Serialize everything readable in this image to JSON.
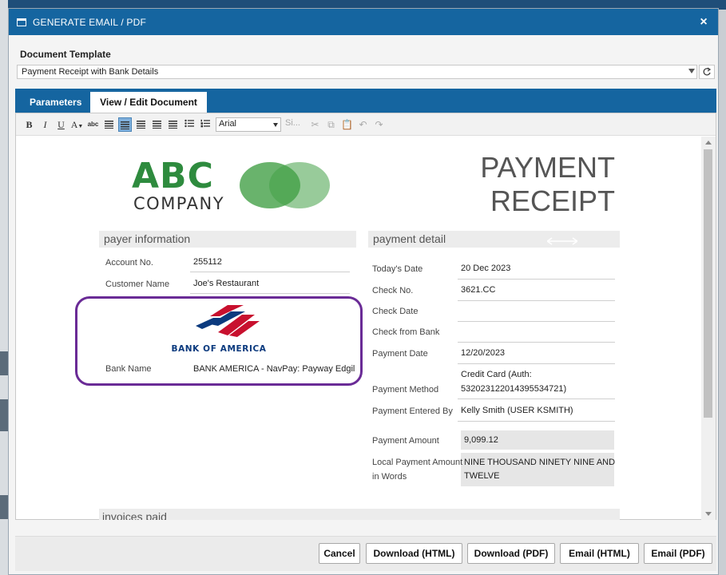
{
  "dialog": {
    "title": "GENERATE EMAIL / PDF",
    "close_label": "×"
  },
  "template": {
    "label": "Document Template",
    "selected": "Payment Receipt with Bank Details"
  },
  "tabs": [
    {
      "label": "Parameters",
      "active": false
    },
    {
      "label": "View / Edit Document",
      "active": true
    }
  ],
  "toolbar": {
    "bold": "B",
    "italic": "I",
    "underline": "U",
    "font_color": "A",
    "spell": "abc",
    "font_family": "Arial",
    "font_size": "Si..."
  },
  "document": {
    "logo": {
      "line1": "ABC",
      "line2": "COMPANY"
    },
    "title_line1": "PAYMENT",
    "title_line2": "RECEIPT",
    "payer_header": "payer information",
    "payer_rows": [
      {
        "label": "Account No.",
        "value": "255112"
      },
      {
        "label": "Customer Name",
        "value": "Joe's Restaurant"
      }
    ],
    "bank_logo_text": "BANK OF AMERICA",
    "bank_row": {
      "label": "Bank Name",
      "value": "BANK AMERICA - NavPay: Payway Edgil"
    },
    "detail_header": "payment detail",
    "detail_rows": [
      {
        "label": "Today's Date",
        "value": "20 Dec 2023"
      },
      {
        "label": "Check No.",
        "value": "3621.CC"
      },
      {
        "label": "Check Date",
        "value": ""
      },
      {
        "label": "Check from Bank",
        "value": ""
      },
      {
        "label": "Payment Date",
        "value": "12/20/2023"
      },
      {
        "label": "Payment Method",
        "value_line1": "Credit Card (Auth:",
        "value_line2": "532023122014395534721)"
      },
      {
        "label": "Payment Entered By",
        "value": "Kelly Smith (USER KSMITH)"
      },
      {
        "label": "Payment Amount",
        "value": "9,099.12"
      },
      {
        "label_line1": "Local Payment Amount",
        "label_line2": "in Words",
        "value_line1": "NINE THOUSAND NINETY NINE AND",
        "value_line2": "TWELVE"
      }
    ],
    "invoices_header": "invoices paid"
  },
  "buttons": {
    "cancel": "Cancel",
    "download_html": "Download (HTML)",
    "download_pdf": "Download (PDF)",
    "email_html": "Email (HTML)",
    "email_pdf": "Email (PDF)"
  },
  "colors": {
    "accent": "#1565a0",
    "highlight_border": "#6a2b96",
    "logo_green": "#2e8b3e"
  }
}
